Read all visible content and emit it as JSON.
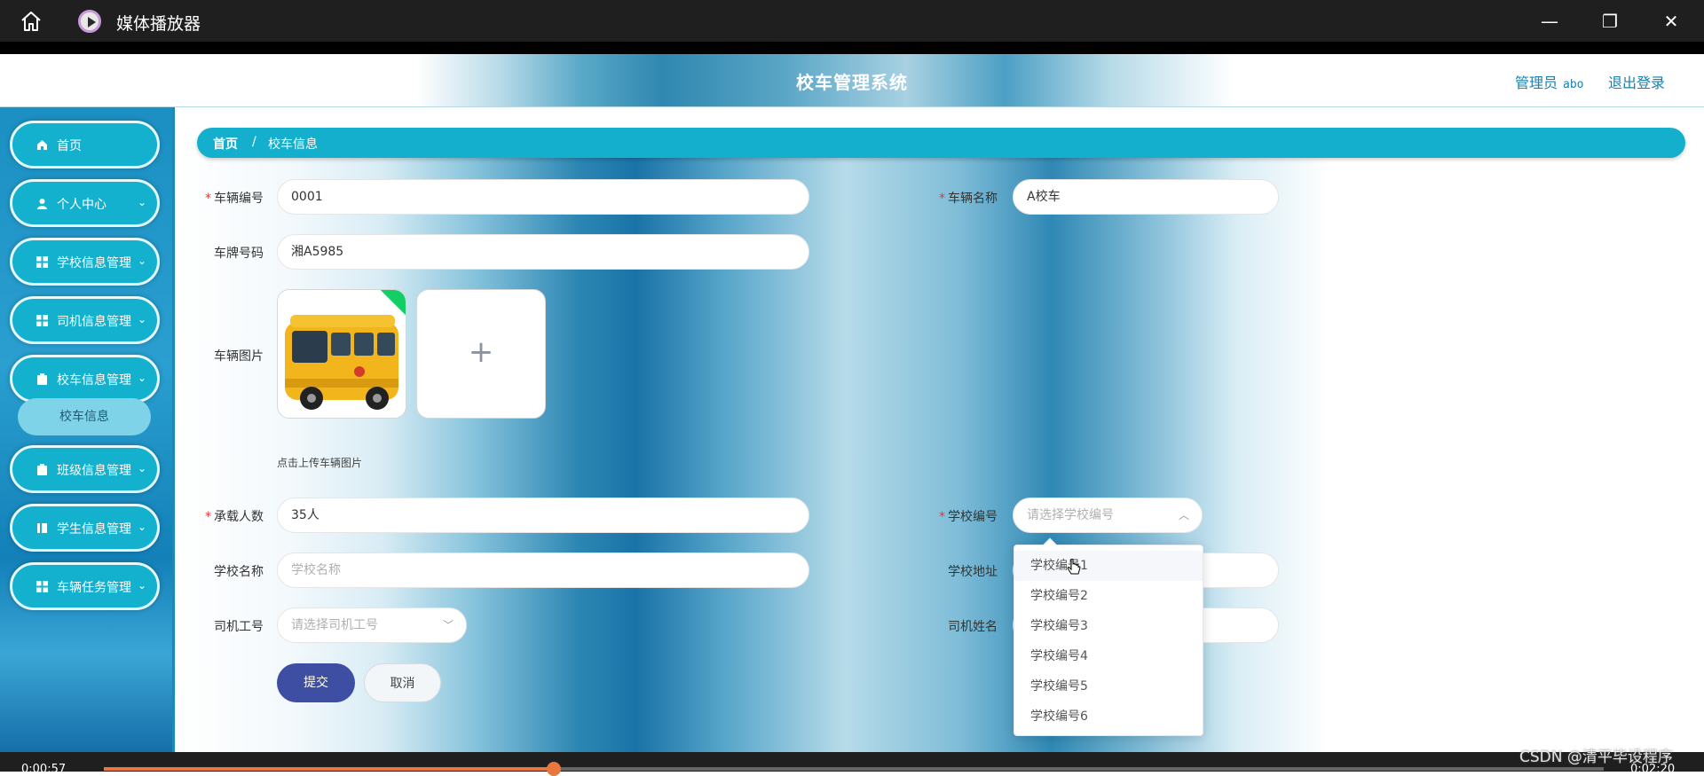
{
  "player": {
    "title": "媒体播放器",
    "minimize": "—",
    "restore": "❐",
    "close": "✕",
    "time_current": "0:00:57",
    "time_total": "0:02:20",
    "progress": 0.3,
    "watermark": "CSDN @清平毕设程序"
  },
  "header": {
    "title": "校车管理系统",
    "admin_label": "管理员",
    "admin_user": "abo",
    "logout": "退出登录"
  },
  "sidebar": {
    "items": [
      {
        "label": "首页",
        "icon": "home-icon",
        "has_chevron": false
      },
      {
        "label": "个人中心",
        "icon": "user-icon",
        "has_chevron": true
      },
      {
        "label": "学校信息管理",
        "icon": "grid-icon",
        "has_chevron": true
      },
      {
        "label": "司机信息管理",
        "icon": "grid-icon",
        "has_chevron": true
      },
      {
        "label": "校车信息管理",
        "icon": "clipboard-icon",
        "has_chevron": true
      },
      {
        "label": "班级信息管理",
        "icon": "clipboard-icon",
        "has_chevron": true
      },
      {
        "label": "学生信息管理",
        "icon": "book-icon",
        "has_chevron": true
      },
      {
        "label": "车辆任务管理",
        "icon": "grid-icon",
        "has_chevron": true
      }
    ],
    "sub_item": "校车信息",
    "chevron": "⌄"
  },
  "breadcrumb": {
    "home": "首页",
    "separator": "/",
    "current": "校车信息"
  },
  "form": {
    "vehicle_no": {
      "label": "车辆编号",
      "value": "0001",
      "required": true
    },
    "vehicle_name": {
      "label": "车辆名称",
      "value": "A校车",
      "required": true
    },
    "plate_no": {
      "label": "车牌号码",
      "value": "湘A5985"
    },
    "vehicle_image": {
      "label": "车辆图片",
      "tip": "点击上传车辆图片",
      "add": "+"
    },
    "capacity": {
      "label": "承载人数",
      "value": "35人",
      "required": true
    },
    "school_no": {
      "label": "学校编号",
      "placeholder": "请选择学校编号",
      "required": true
    },
    "school_name": {
      "label": "学校名称",
      "placeholder": "学校名称"
    },
    "school_address": {
      "label": "学校地址"
    },
    "driver_no": {
      "label": "司机工号",
      "placeholder": "请选择司机工号"
    },
    "driver_name": {
      "label": "司机姓名"
    },
    "required_mark": "*",
    "select_up": "︿",
    "select_down": "﹀"
  },
  "buttons": {
    "submit": "提交",
    "cancel": "取消"
  },
  "dropdown": {
    "options": [
      "学校编号1",
      "学校编号2",
      "学校编号3",
      "学校编号4",
      "学校编号5",
      "学校编号6"
    ]
  },
  "colors": {
    "accent": "#14afcd",
    "submit": "#3d4ea3",
    "required": "#ee3333",
    "progress": "#e8773d"
  }
}
